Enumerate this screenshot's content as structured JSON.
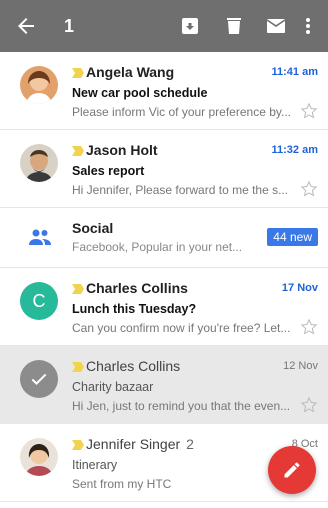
{
  "toolbar": {
    "selected_count": "1"
  },
  "threads": [
    {
      "sender": "Angela Wang",
      "time": "11:41 am",
      "subject": "New car pool schedule",
      "snippet": "Please inform Vic of your preference by..."
    },
    {
      "sender": "Jason Holt",
      "time": "11:32 am",
      "subject": "Sales report",
      "snippet": "Hi Jennifer, Please forward to me the s..."
    },
    {
      "sender": "Charles Collins",
      "time": "17 Nov",
      "subject": "Lunch this Tuesday?",
      "snippet": "Can you confirm now if you're free? Let...",
      "avatar_letter": "C"
    },
    {
      "sender": "Charles Collins",
      "time": "12 Nov",
      "subject": "Charity bazaar",
      "snippet": "Hi Jen, just to remind you that the even..."
    },
    {
      "sender": "Jennifer Singer",
      "count": "2",
      "time": "8 Oct",
      "subject": "Itinerary",
      "snippet": "Sent from my HTC"
    }
  ],
  "social": {
    "title": "Social",
    "snippet": "Facebook, Popular in your net...",
    "badge": "44 new"
  },
  "colors": {
    "appbar": "#6f6f6f",
    "accent_blue": "#1e63d6",
    "important_marker": "#f2d34f",
    "fab": "#e53935"
  }
}
